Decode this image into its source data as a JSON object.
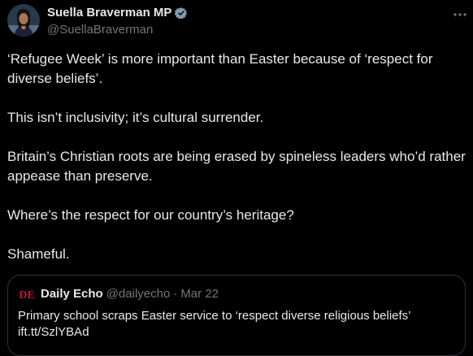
{
  "author": {
    "display_name": "Suella Braverman MP",
    "handle": "@SuellaBraverman",
    "avatar_icon": "profile-photo",
    "verified_icon": "verified-badge-icon",
    "verified_color": "#829aab"
  },
  "more_icon": "more-horizontal-icon",
  "tweet": {
    "paragraphs": [
      "‘Refugee Week’ is more important than Easter because of  ‘respect for diverse beliefs’.",
      "This isn’t inclusivity; it’s cultural surrender.",
      "Britain’s Christian roots are being erased by spineless leaders who’d rather appease than preserve.",
      "Where’s the respect for our country’s heritage?",
      "Shameful."
    ]
  },
  "quote": {
    "logo_text": "DE",
    "logo_color": "#c8102e",
    "display_name": "Daily Echo",
    "handle": "@dailyecho",
    "separator": "·",
    "date": "Mar 22",
    "text": "Primary school scraps Easter service to ‘respect diverse religious beliefs’",
    "link": "ift.tt/SzlYBAd"
  },
  "colors": {
    "background": "#000000",
    "text_primary": "#e7e9ea",
    "text_secondary": "#71767b",
    "border": "#2f3336"
  }
}
